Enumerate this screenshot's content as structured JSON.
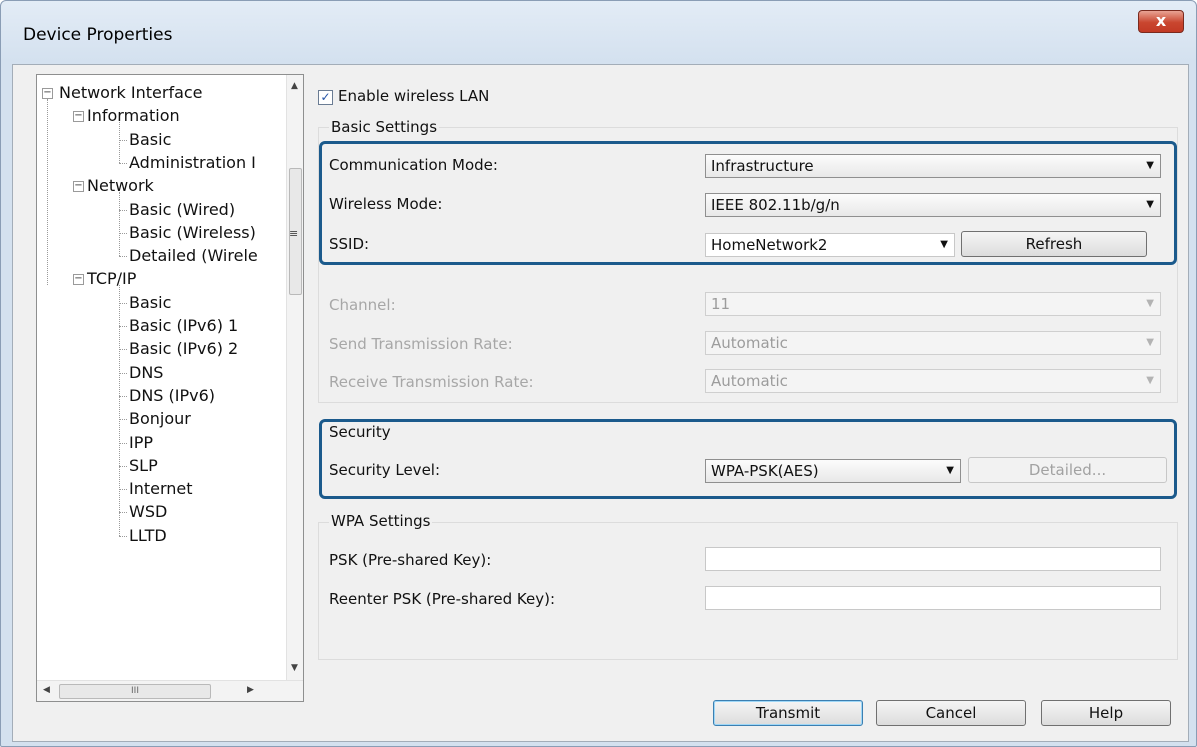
{
  "window": {
    "title": "Device Properties",
    "close_glyph": "x"
  },
  "tree": {
    "items": [
      {
        "label": "Network Interface",
        "level": 0,
        "expanded": true
      },
      {
        "label": "Information",
        "level": 1,
        "expanded": true
      },
      {
        "label": "Basic",
        "level": 2
      },
      {
        "label": "Administration I",
        "level": 2
      },
      {
        "label": "Network",
        "level": 1,
        "expanded": true
      },
      {
        "label": "Basic (Wired)",
        "level": 2
      },
      {
        "label": "Basic (Wireless)",
        "level": 2
      },
      {
        "label": "Detailed (Wirele",
        "level": 2
      },
      {
        "label": "TCP/IP",
        "level": 1,
        "expanded": true
      },
      {
        "label": "Basic",
        "level": 2
      },
      {
        "label": "Basic (IPv6) 1",
        "level": 2
      },
      {
        "label": "Basic (IPv6) 2",
        "level": 2
      },
      {
        "label": "DNS",
        "level": 2
      },
      {
        "label": "DNS (IPv6)",
        "level": 2
      },
      {
        "label": "Bonjour",
        "level": 2
      },
      {
        "label": "IPP",
        "level": 2
      },
      {
        "label": "SLP",
        "level": 2
      },
      {
        "label": "Internet",
        "level": 2
      },
      {
        "label": "WSD",
        "level": 2
      },
      {
        "label": "LLTD",
        "level": 2
      }
    ],
    "hscroll_grip": "III"
  },
  "enable_wireless": {
    "label": "Enable wireless LAN",
    "checked": true,
    "check_glyph": "✓"
  },
  "basic_settings": {
    "heading": "Basic Settings",
    "communication_mode": {
      "label": "Communication Mode:",
      "value": "Infrastructure"
    },
    "wireless_mode": {
      "label": "Wireless Mode:",
      "value": "IEEE 802.11b/g/n"
    },
    "ssid": {
      "label": "SSID:",
      "value": "HomeNetwork2"
    },
    "refresh_label": "Refresh",
    "channel": {
      "label": "Channel:",
      "value": "11"
    },
    "send_rate": {
      "label": "Send Transmission Rate:",
      "value": "Automatic"
    },
    "receive_rate": {
      "label": "Receive Transmission Rate:",
      "value": "Automatic"
    }
  },
  "security": {
    "heading": "Security",
    "level": {
      "label": "Security Level:",
      "value": "WPA-PSK(AES)"
    },
    "detailed_label": "Detailed..."
  },
  "wpa": {
    "heading": "WPA Settings",
    "psk": {
      "label": "PSK (Pre-shared Key):",
      "value": ""
    },
    "reenter_psk": {
      "label": "Reenter PSK (Pre-shared Key):",
      "value": ""
    }
  },
  "buttons": {
    "transmit": "Transmit",
    "cancel": "Cancel",
    "help": "Help"
  },
  "colors": {
    "highlight_border": "#1b5a8c",
    "close_button": "#c9462f",
    "window_frame": "#d4e1ef"
  }
}
